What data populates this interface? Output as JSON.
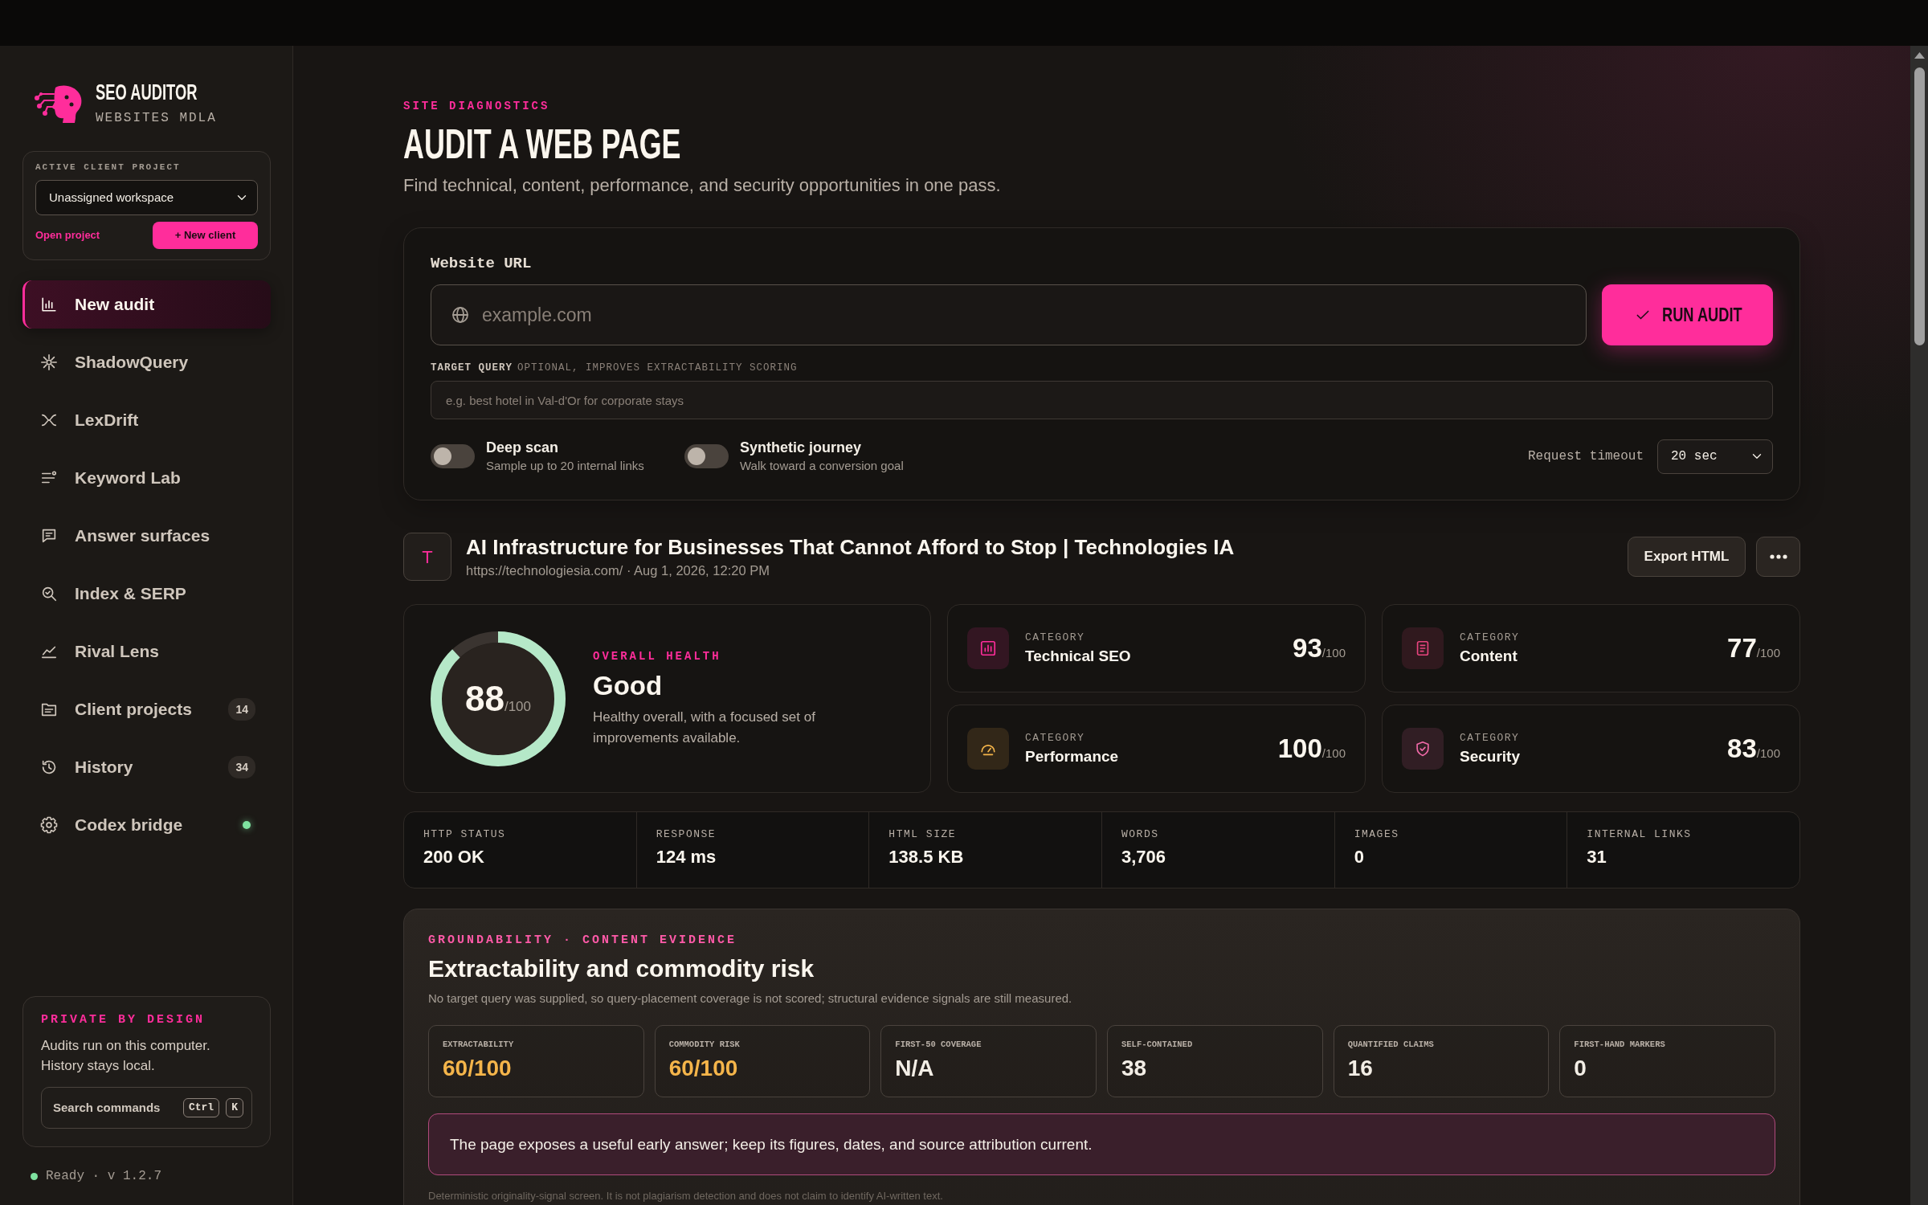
{
  "sidebar": {
    "brand": {
      "name": "SEO AUDITOR",
      "subtitle": "WEBSITES MDLA"
    },
    "client_project": {
      "label": "ACTIVE CLIENT PROJECT",
      "value": "Unassigned workspace",
      "link": "Open project",
      "button": "+ New client"
    },
    "items": [
      {
        "label": "New audit",
        "selected": true,
        "online": false
      },
      {
        "label": "ShadowQuery",
        "selected": false,
        "online": false
      },
      {
        "label": "LexDrift",
        "selected": false,
        "online": false
      },
      {
        "label": "Keyword Lab",
        "selected": false,
        "online": false
      },
      {
        "label": "Answer surfaces",
        "selected": false,
        "online": false
      },
      {
        "label": "Index & SERP",
        "selected": false,
        "online": false
      },
      {
        "label": "Rival Lens",
        "selected": false,
        "online": false
      },
      {
        "label": "Client projects",
        "badge": "14",
        "selected": false,
        "online": false
      },
      {
        "label": "History",
        "badge": "34",
        "selected": false,
        "online": false
      },
      {
        "label": "Codex bridge",
        "selected": false,
        "online": true
      }
    ],
    "privacy": {
      "title": "PRIVATE BY DESIGN",
      "text": "Audits run on this computer. History stays local.",
      "search_label": "Search commands",
      "keys": [
        "Ctrl",
        "K"
      ]
    },
    "status": {
      "text": "Ready · v 1.2.7",
      "online": true
    }
  },
  "header": {
    "eyebrow": "SITE DIAGNOSTICS",
    "title": "AUDIT A WEB PAGE",
    "subtitle": "Find technical, content, performance, and security opportunities in one pass."
  },
  "audit_form": {
    "url_field": {
      "label": "Website URL",
      "placeholder": "example.com"
    },
    "run_button": "RUN AUDIT",
    "query_field": {
      "label": "TARGET QUERY",
      "hint": "OPTIONAL, IMPROVES EXTRACTABILITY SCORING",
      "placeholder": "e.g. best hotel in Val-d'Or for corporate stays"
    },
    "toggles": [
      {
        "label": "Deep scan",
        "description": "Sample up to 20 internal links",
        "on": false
      },
      {
        "label": "Synthetic journey",
        "description": "Walk toward a conversion goal",
        "on": false
      }
    ],
    "timeout": {
      "label": "Request timeout",
      "value": "20 sec"
    }
  },
  "result": {
    "initial": "T",
    "title": "AI Infrastructure for Businesses That Cannot Afford to Stop | Technologies IA",
    "meta": "https://technologiesia.com/ · Aug 1, 2026, 12:20 PM",
    "export_button": "Export HTML"
  },
  "health": {
    "score": "88",
    "max": "/100",
    "level": 0.88,
    "eyebrow": "OVERALL HEALTH",
    "rating": "Good",
    "description": "Healthy overall, with a focused set of improvements available."
  },
  "categories": [
    {
      "label": "CATEGORY",
      "name": "Technical SEO",
      "score": "93",
      "max": "/100",
      "color": "#ff2d9b"
    },
    {
      "label": "CATEGORY",
      "name": "Content",
      "score": "77",
      "max": "/100",
      "color": "#e8457f"
    },
    {
      "label": "CATEGORY",
      "name": "Performance",
      "score": "100",
      "max": "/100",
      "color": "#f5b54a"
    },
    {
      "label": "CATEGORY",
      "name": "Security",
      "score": "83",
      "max": "/100",
      "color": "#f06aa8"
    }
  ],
  "stats": [
    {
      "label": "HTTP STATUS",
      "value": "200 OK"
    },
    {
      "label": "RESPONSE",
      "value": "124 ms"
    },
    {
      "label": "HTML SIZE",
      "value": "138.5 KB"
    },
    {
      "label": "WORDS",
      "value": "3,706"
    },
    {
      "label": "IMAGES",
      "value": "0"
    },
    {
      "label": "INTERNAL LINKS",
      "value": "31"
    }
  ],
  "groundability": {
    "eyebrow": "GROUNDABILITY · CONTENT EVIDENCE",
    "title": "Extractability and commodity risk",
    "note": "No target query was supplied, so query-placement coverage is not scored; structural evidence signals are still measured.",
    "metrics": [
      {
        "label": "EXTRACTABILITY",
        "value": "60/100",
        "color": "#f5b54a"
      },
      {
        "label": "COMMODITY RISK",
        "value": "60/100",
        "color": "#f5b54a"
      },
      {
        "label": "FIRST-50 COVERAGE",
        "value": "N/A",
        "color": "#f3eee6"
      },
      {
        "label": "SELF-CONTAINED",
        "value": "38",
        "color": "#f3eee6"
      },
      {
        "label": "QUANTIFIED CLAIMS",
        "value": "16",
        "color": "#f3eee6"
      },
      {
        "label": "FIRST-HAND MARKERS",
        "value": "0",
        "color": "#f3eee6"
      }
    ],
    "callout": "The page exposes a useful early answer; keep its figures, dates, and source attribution current.",
    "footnote": "Deterministic originality-signal screen. It is not plagiarism detection and does not claim to identify AI-written text."
  }
}
